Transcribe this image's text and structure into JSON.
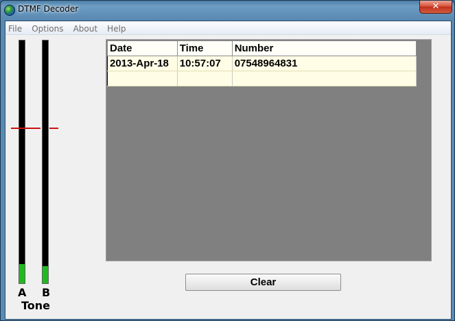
{
  "window": {
    "title": "DTMF Decoder",
    "close_glyph": "✕"
  },
  "menu": {
    "items": [
      "File",
      "Options",
      "About",
      "Help"
    ]
  },
  "meters": {
    "a": {
      "label": "A",
      "level": 0.08
    },
    "b": {
      "label": "B",
      "level": 0.07
    },
    "threshold": 0.64,
    "group_label": "Tone"
  },
  "log": {
    "columns": [
      "Date",
      "Time",
      "Number"
    ],
    "rows": [
      [
        "2013-Apr-18",
        "10:57:07",
        "07548964831"
      ],
      [
        "",
        "",
        ""
      ]
    ]
  },
  "buttons": {
    "clear": "Clear"
  },
  "colors": {
    "meter_fill": "#1fba1f",
    "threshold": "#cc1010",
    "grid_bg": "#808080"
  }
}
